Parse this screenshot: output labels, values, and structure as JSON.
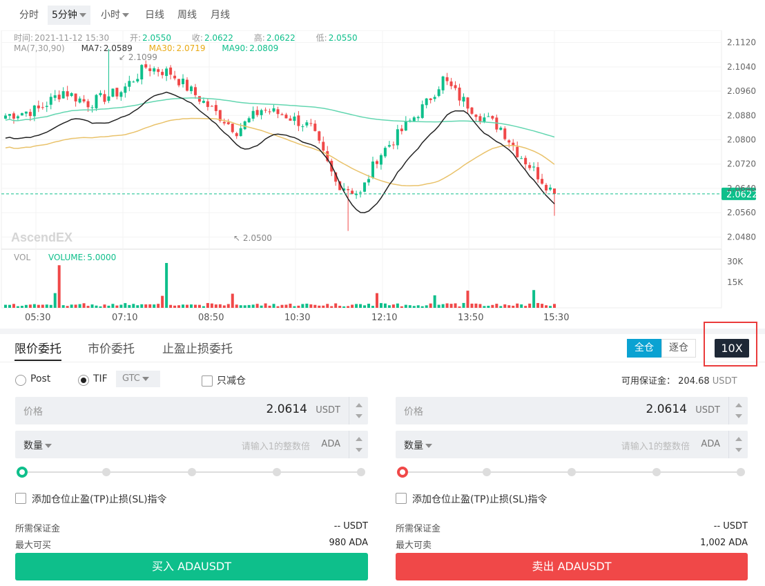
{
  "timeframes": [
    "分时",
    "5分钟",
    "小时",
    "日线",
    "周线",
    "月线"
  ],
  "info": {
    "time_label": "时间:",
    "time": "2021-11-12 15:30",
    "open_label": "开:",
    "open": "2.0550",
    "close_label": "收:",
    "close": "2.0622",
    "high_label": "高:",
    "high": "2.0622",
    "low_label": "低:",
    "low": "2.0550",
    "ma_label": "MA(7,30,90)",
    "ma7_label": "MA7:",
    "ma7": "2.0589",
    "ma30_label": "MA30:",
    "ma30": "2.0719",
    "ma90_label": "MA90:",
    "ma90": "2.0809",
    "vol_label": "VOL",
    "volume_label": "VOLUME:",
    "volume": "5.0000"
  },
  "chart": {
    "watermark": "AscendEX",
    "max_label": "2.1099",
    "min_label": "2.0500",
    "current_price": "2.0622",
    "price_ticks": [
      "2.1120",
      "2.1040",
      "2.0960",
      "2.0880",
      "2.0800",
      "2.0720",
      "2.0640",
      "2.0560",
      "2.0480"
    ],
    "volume_ticks": [
      "30K",
      "15K"
    ],
    "time_ticks": [
      "05:30",
      "07:10",
      "08:50",
      "10:30",
      "12:10",
      "13:50",
      "15:30"
    ],
    "colors": {
      "up": "#0ebf8b",
      "down": "#f04848",
      "ma7": "#222222",
      "ma30": "#e9c26a",
      "ma90": "#62d6b0"
    }
  },
  "chart_data": {
    "type": "candlestick",
    "x_ticks": [
      "05:30",
      "07:10",
      "08:50",
      "10:30",
      "12:10",
      "13:50",
      "15:30"
    ],
    "ylim": [
      2.044,
      2.116
    ],
    "max": {
      "value": 2.1099
    },
    "min": {
      "value": 2.05
    },
    "last": {
      "time": "2021-11-12 15:30",
      "open": 2.055,
      "close": 2.0622,
      "high": 2.0622,
      "low": 2.055
    },
    "ma": {
      "MA7": 2.0589,
      "MA30": 2.0719,
      "MA90": 2.0809
    },
    "volume_last": 5.0
  },
  "order": {
    "tabs": [
      "限价委托",
      "市价委托",
      "止盈止损委托"
    ],
    "margin_modes": [
      "全仓",
      "逐仓"
    ],
    "leverage": "10X",
    "post_label": "Post",
    "tif_label": "TIF",
    "tif_value": "GTC",
    "reduce_only_label": "只减仓",
    "available_label": "可用保证金：",
    "available_value": "204.68",
    "available_unit": "USDT",
    "buy": {
      "price_placeholder": "价格",
      "price_value": "2.0614",
      "price_unit": "USDT",
      "qty_label": "数量",
      "qty_placeholder": "请输入1的整数倍",
      "qty_unit": "ADA",
      "tpsl_label": "添加仓位止盈(TP)止损(SL)指令",
      "margin_label": "所需保证金",
      "margin_value": "-- USDT",
      "max_label": "最大可买",
      "max_value": "980 ADA",
      "button": "买入 ADAUSDT"
    },
    "sell": {
      "price_placeholder": "价格",
      "price_value": "2.0614",
      "price_unit": "USDT",
      "qty_label": "数量",
      "qty_placeholder": "请输入1的整数倍",
      "qty_unit": "ADA",
      "tpsl_label": "添加仓位止盈(TP)止损(SL)指令",
      "margin_label": "所需保证金",
      "margin_value": "-- USDT",
      "max_label": "最大可卖",
      "max_value": "1,002 ADA",
      "button": "卖出 ADAUSDT"
    }
  }
}
